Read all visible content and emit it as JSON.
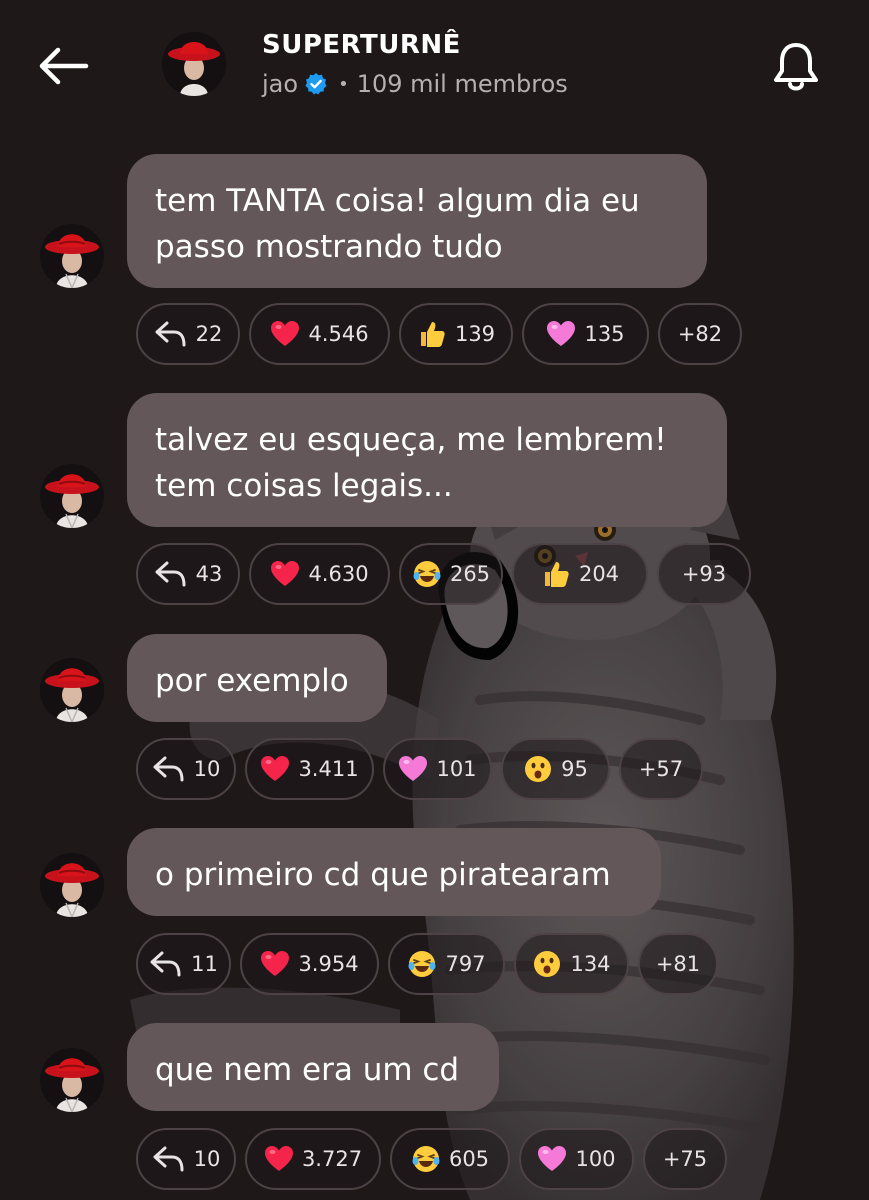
{
  "header": {
    "title": "SUPERTURNÊ",
    "author": "jao",
    "member_count": "109 mil membros",
    "back_icon": "arrow-left-icon",
    "bell_icon": "bell-icon"
  },
  "colors": {
    "background": "#1e1819",
    "bubble": "#63575a",
    "chip_border": "#4d4245",
    "verified": "#1d9bf0",
    "hat_red": "#d8141a"
  },
  "messages": [
    {
      "lines": [
        "tem TANTA coisa! algum dia eu",
        "passo mostrando tudo"
      ],
      "replies": "22",
      "reactions": [
        {
          "icon": "red-heart-icon",
          "count": "4.546"
        },
        {
          "icon": "thumbs-up-icon",
          "count": "139"
        },
        {
          "icon": "pink-heart-icon",
          "count": "135"
        }
      ],
      "more": "+82"
    },
    {
      "lines": [
        "talvez eu esqueça, me lembrem!",
        "tem coisas legais..."
      ],
      "replies": "43",
      "reactions": [
        {
          "icon": "red-heart-icon",
          "count": "4.630"
        },
        {
          "icon": "laughing-face-icon",
          "count": "265"
        },
        {
          "icon": "thumbs-up-icon",
          "count": "204"
        }
      ],
      "more": "+93"
    },
    {
      "lines": [
        "por exemplo"
      ],
      "replies": "10",
      "reactions": [
        {
          "icon": "red-heart-icon",
          "count": "3.411"
        },
        {
          "icon": "pink-heart-icon",
          "count": "101"
        },
        {
          "icon": "surprised-face-icon",
          "count": "95"
        }
      ],
      "more": "+57"
    },
    {
      "lines": [
        "o primeiro cd que piratearam"
      ],
      "replies": "11",
      "reactions": [
        {
          "icon": "red-heart-icon",
          "count": "3.954"
        },
        {
          "icon": "laughing-face-icon",
          "count": "797"
        },
        {
          "icon": "surprised-face-icon",
          "count": "134"
        }
      ],
      "more": "+81"
    },
    {
      "lines": [
        "que nem era um cd"
      ],
      "replies": "10",
      "reactions": [
        {
          "icon": "red-heart-icon",
          "count": "3.727"
        },
        {
          "icon": "laughing-face-icon",
          "count": "605"
        },
        {
          "icon": "pink-heart-icon",
          "count": "100"
        }
      ],
      "more": "+75"
    }
  ]
}
